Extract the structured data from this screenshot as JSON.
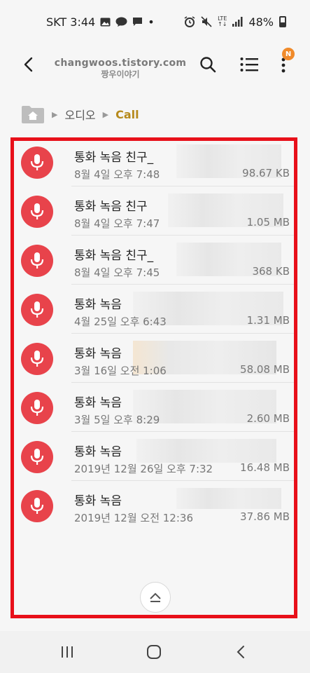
{
  "status": {
    "carrier_time": "SKT 3:44",
    "dot": "•",
    "lte": "LTE",
    "battery": "48%"
  },
  "header": {
    "watermark": "changwoos.tistory.com",
    "watermark_sub": "짱우이야기",
    "badge": "N"
  },
  "breadcrumb": {
    "audio": "오디오",
    "call": "Call"
  },
  "files": [
    {
      "name": "통화 녹음 친구_",
      "date": "8월 4일 오후 7:48",
      "size": "98.67 KB"
    },
    {
      "name": "통화 녹음 친구",
      "date": "8월 4일 오후 7:47",
      "size": "1.05 MB"
    },
    {
      "name": "통화 녹음 친구_",
      "date": "8월 4일 오후 7:45",
      "size": "368 KB"
    },
    {
      "name": "통화 녹음",
      "date": "4월 25일 오후 6:43",
      "size": "1.31 MB"
    },
    {
      "name": "통화 녹음",
      "date": "3월 16일 오전 1:06",
      "size": "58.08 MB"
    },
    {
      "name": "통화 녹음",
      "date": "3월 5일 오후 8:29",
      "size": "2.60 MB"
    },
    {
      "name": "통화 녹음",
      "date": "2019년 12월 26일 오후 7:32",
      "size": "16.48 MB"
    },
    {
      "name": "통화 녹음",
      "date": "2019년 12월 오전 12:36",
      "size": "37.86 MB"
    }
  ],
  "colors": {
    "mic": "#e8434b",
    "highlight_frame": "#e8101a",
    "breadcrumb_active": "#b68a1c",
    "badge": "#f08a2a"
  }
}
